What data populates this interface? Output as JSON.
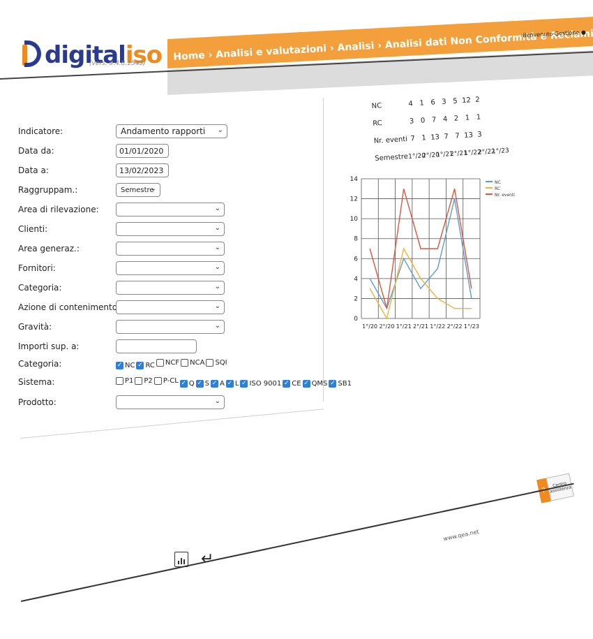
{
  "header": {
    "logo_dig": "digital",
    "logo_iso": "iso",
    "version": "(vers. 9.4.8.1545)",
    "breadcrumb": "Home › Analisi e valutazioni › Analisi › Analisi dati Non Conformità e Reclami",
    "user": "Benvenuto Gestione"
  },
  "form": {
    "indicatore": {
      "label": "Indicatore:",
      "value": "Andamento rapporti"
    },
    "data_da": {
      "label": "Data da:",
      "value": "01/01/2020"
    },
    "data_a": {
      "label": "Data a:",
      "value": "13/02/2023"
    },
    "raggruppam": {
      "label": "Raggruppam.:",
      "value": "Semestre"
    },
    "area_rilevazione": {
      "label": "Area di rilevazione:",
      "value": ""
    },
    "clienti": {
      "label": "Clienti:",
      "value": ""
    },
    "area_generaz": {
      "label": "Area generaz.:",
      "value": ""
    },
    "fornitori": {
      "label": "Fornitori:",
      "value": ""
    },
    "categoria_sel": {
      "label": "Categoria:",
      "value": ""
    },
    "azione": {
      "label": "Azione di contenimento:",
      "value": ""
    },
    "gravita": {
      "label": "Gravità:",
      "value": ""
    },
    "importi": {
      "label": "Importi sup. a:",
      "value": ""
    },
    "categoria_cb": {
      "label": "Categoria:",
      "options": [
        {
          "label": "NC",
          "checked": true
        },
        {
          "label": "RC",
          "checked": true
        },
        {
          "label": "NCF",
          "checked": false
        },
        {
          "label": "NCA",
          "checked": false
        },
        {
          "label": "SQI",
          "checked": false
        }
      ]
    },
    "sistema": {
      "label": "Sistema:",
      "options": [
        {
          "label": "P1",
          "checked": false
        },
        {
          "label": "P2",
          "checked": false
        },
        {
          "label": "P-CL",
          "checked": false
        },
        {
          "label": "Q",
          "checked": true
        },
        {
          "label": "S",
          "checked": true
        },
        {
          "label": "A",
          "checked": true
        },
        {
          "label": "L",
          "checked": true
        },
        {
          "label": "ISO 9001",
          "checked": true
        },
        {
          "label": "CE",
          "checked": true
        },
        {
          "label": "QMS",
          "checked": true
        },
        {
          "label": "SB1",
          "checked": true
        }
      ]
    },
    "prodotto": {
      "label": "Prodotto:",
      "value": ""
    }
  },
  "stats": {
    "rows": [
      {
        "name": "NC",
        "values": [
          "4",
          "1",
          "6",
          "3",
          "5",
          "12",
          "2"
        ]
      },
      {
        "name": "RC",
        "values": [
          "3",
          "0",
          "7",
          "4",
          "2",
          "1",
          "1"
        ]
      },
      {
        "name": "Nr. eventi",
        "values": [
          "7",
          "1",
          "13",
          "7",
          "7",
          "13",
          "3"
        ]
      },
      {
        "name": "Semestre",
        "values": [
          "1°/20",
          "2°/20",
          "1°/21",
          "2°/21",
          "1°/22",
          "2°/22",
          "1°/23"
        ]
      }
    ]
  },
  "chart_data": {
    "type": "line",
    "categories": [
      "1°/20",
      "2°/20",
      "1°/21",
      "2°/21",
      "1°/22",
      "2°/22",
      "1°/23"
    ],
    "series": [
      {
        "name": "NC",
        "color": "#5b9bd5",
        "values": [
          4,
          1,
          6,
          3,
          5,
          12,
          2
        ]
      },
      {
        "name": "RC",
        "color": "#f2b13c",
        "values": [
          3,
          0,
          7,
          4,
          2,
          1,
          1
        ]
      },
      {
        "name": "Nr. eventi",
        "color": "#e0533a",
        "values": [
          7,
          1,
          13,
          7,
          7,
          13,
          3
        ]
      }
    ],
    "ylim": [
      0,
      14
    ],
    "yticks": [
      "0",
      "2",
      "4",
      "6",
      "8",
      "10",
      "12",
      "14"
    ],
    "grid": true,
    "legend": "top-right"
  },
  "footer": {
    "site": "www.qea.net",
    "help_label": "Centro assistenza",
    "help_q": "?"
  }
}
